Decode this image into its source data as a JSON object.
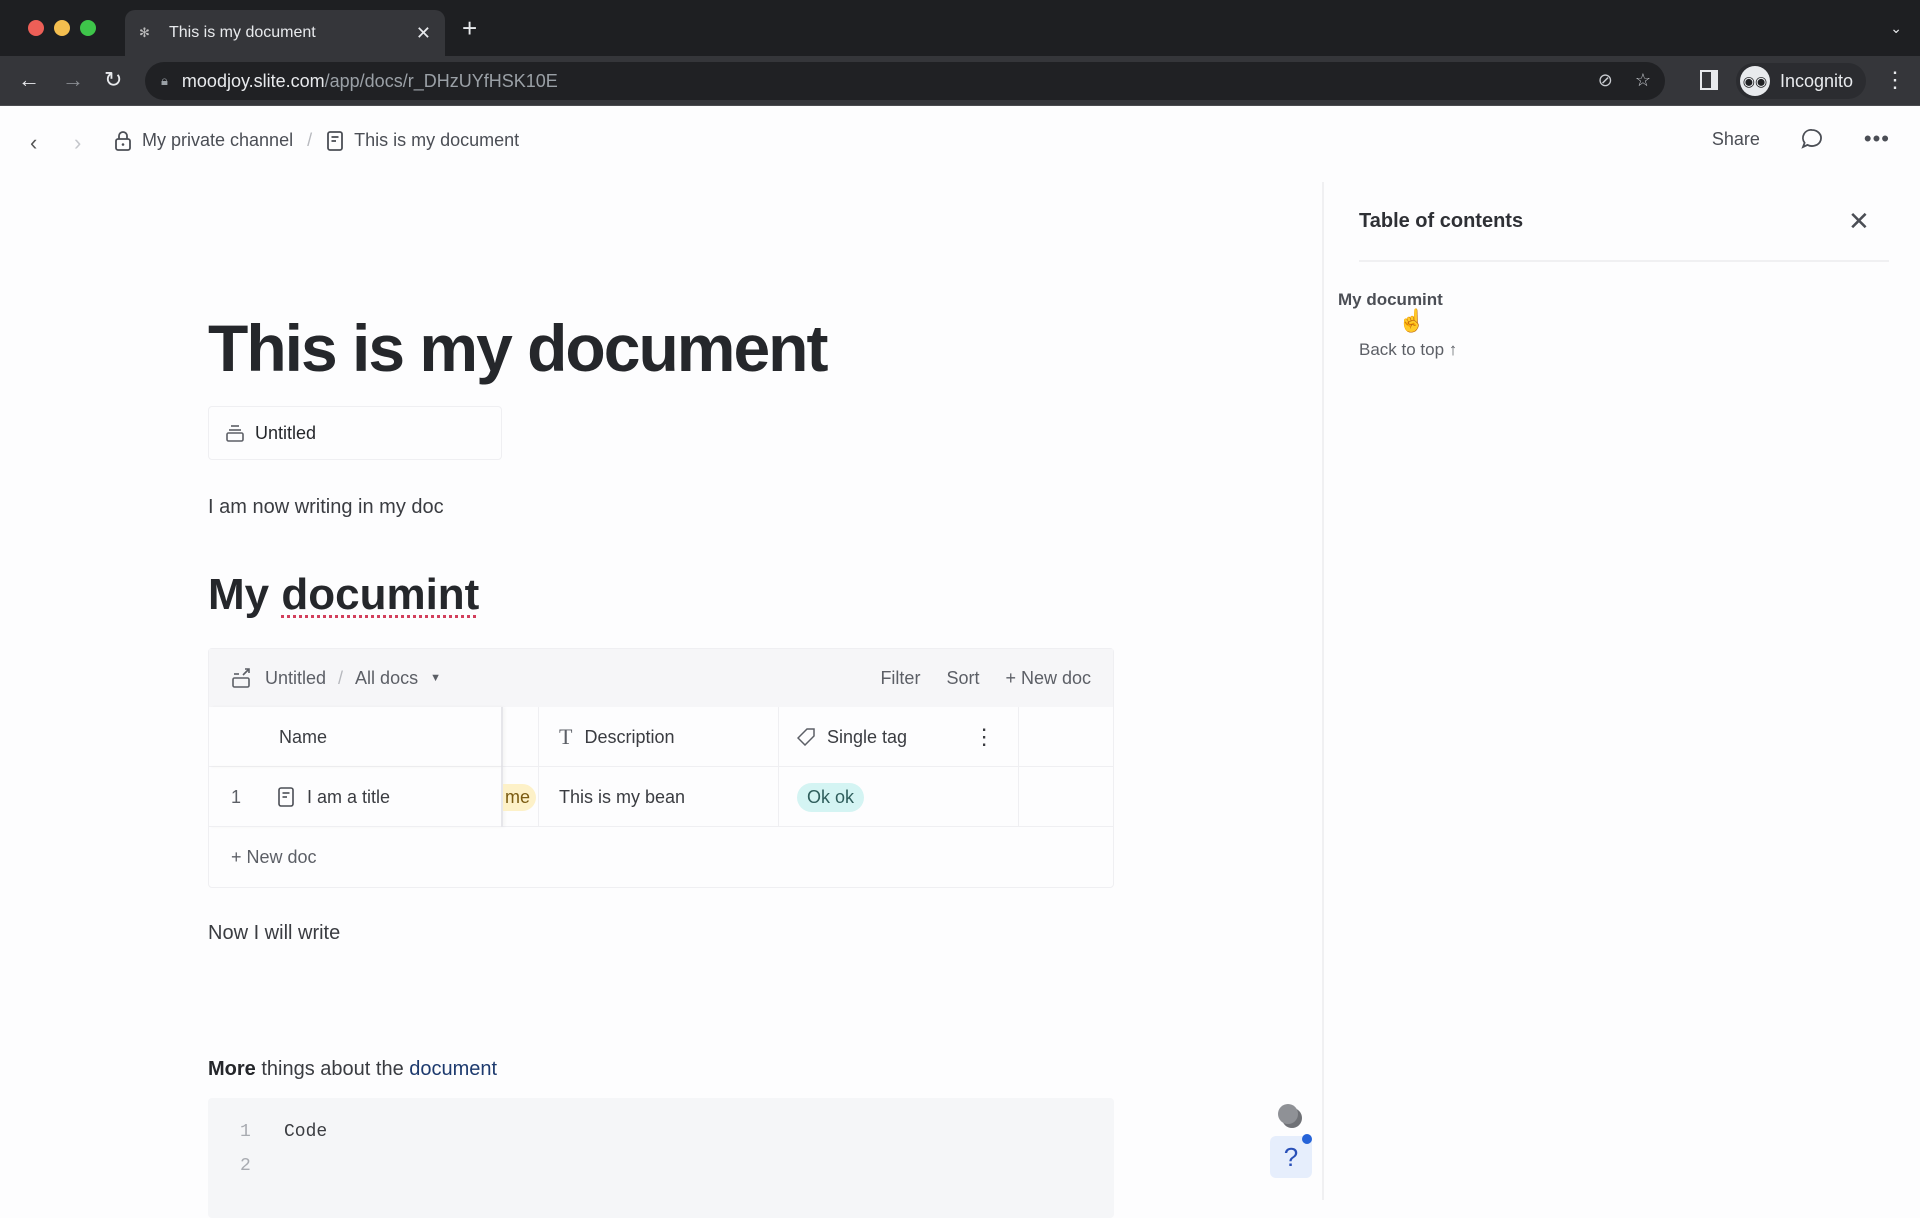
{
  "browser": {
    "tab_title": "This is my document",
    "new_tab": "+",
    "url_host": "moodjoy.slite.com",
    "url_path": "/app/docs/r_DHzUYfHSK10E",
    "profile_label": "Incognito"
  },
  "header": {
    "breadcrumb": [
      {
        "label": "My private channel",
        "icon": "lock-icon"
      },
      {
        "label": "This is my document",
        "icon": "document-icon"
      }
    ],
    "separator": "/",
    "share_label": "Share"
  },
  "doc": {
    "title": "This is my document",
    "collection_chip": "Untitled",
    "paragraph1": "I am now writing in my doc",
    "heading_word1": "My",
    "heading_word2": "documint",
    "table": {
      "collection": "Untitled",
      "view": "All docs",
      "filter_label": "Filter",
      "sort_label": "Sort",
      "new_doc_label": "+ New doc",
      "columns": [
        "Name",
        "Description",
        "Single tag"
      ],
      "rows": [
        {
          "index": "1",
          "name": "I am a title",
          "hidden_pill": "me",
          "description": "This is my bean",
          "tag": "Ok ok"
        }
      ],
      "footer_new_doc": "+ New doc"
    },
    "paragraph2": "Now I will write",
    "paragraph3": {
      "bold": "More",
      "middle": " things about the ",
      "link": "document"
    },
    "code": {
      "lines": [
        {
          "n": "1",
          "text": "Code"
        },
        {
          "n": "2",
          "text": ""
        }
      ]
    }
  },
  "toc": {
    "title": "Table of contents",
    "items": [
      "My documint"
    ],
    "back_to_top": "Back to top ↑"
  },
  "help": {
    "label": "?"
  },
  "colors": {
    "tag_bg": "#d4f4f3",
    "pill_bg": "#fdf1c8",
    "link": "#1d3a6e",
    "help_accent": "#2563d8"
  }
}
